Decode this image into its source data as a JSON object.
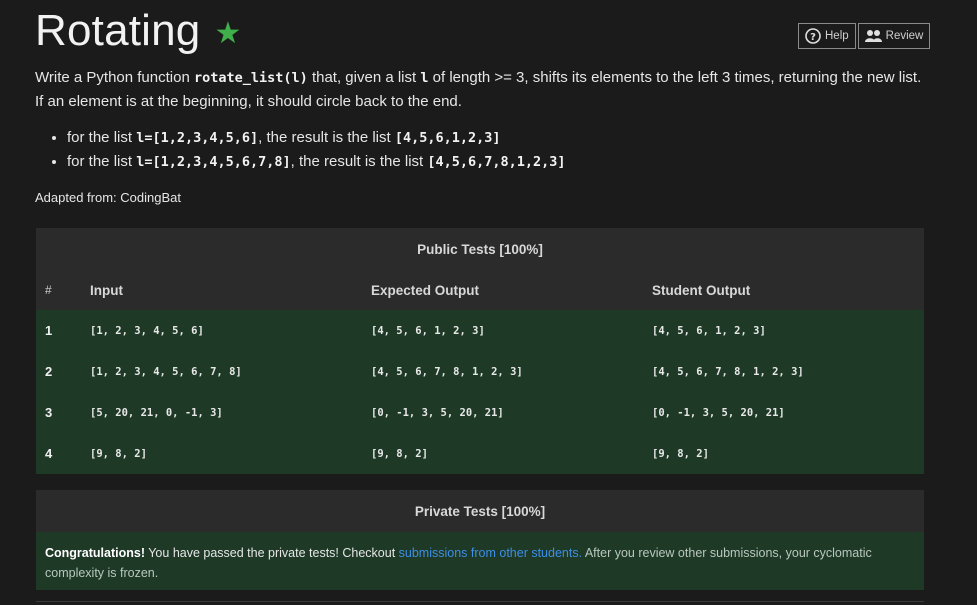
{
  "title": "Rotating",
  "header_buttons": {
    "help": "Help",
    "review": "Review"
  },
  "description": {
    "p1": "Write a Python function ",
    "func": "rotate_list(l)",
    "p2": " that, given a list ",
    "var": "l",
    "p3": " of length >= 3, shifts its elements to the left 3 times, returning the new list. If an element is at the beginning, it should circle back to the end."
  },
  "examples": [
    {
      "pre": "for the list ",
      "input": "l=[1,2,3,4,5,6]",
      "mid": ", the result is the list ",
      "output": "[4,5,6,1,2,3]"
    },
    {
      "pre": "for the list ",
      "input": "l=[1,2,3,4,5,6,7,8]",
      "mid": ", the result is the list ",
      "output": "[4,5,6,7,8,1,2,3]"
    }
  ],
  "adapted": "Adapted from: CodingBat",
  "public_tests": {
    "title": "Public Tests [100%]",
    "columns": [
      "#",
      "Input",
      "Expected Output",
      "Student Output"
    ],
    "rows": [
      [
        "1",
        "[1, 2, 3, 4, 5, 6]",
        "[4, 5, 6, 1, 2, 3]",
        "[4, 5, 6, 1, 2, 3]"
      ],
      [
        "2",
        "[1, 2, 3, 4, 5, 6, 7, 8]",
        "[4, 5, 6, 7, 8, 1, 2, 3]",
        "[4, 5, 6, 7, 8, 1, 2, 3]"
      ],
      [
        "3",
        "[5, 20, 21, 0, -1, 3]",
        "[0, -1, 3, 5, 20, 21]",
        "[0, -1, 3, 5, 20, 21]"
      ],
      [
        "4",
        "[9, 8, 2]",
        "[9, 8, 2]",
        "[9, 8, 2]"
      ]
    ]
  },
  "private_tests": {
    "title": "Private Tests [100%]",
    "congrats": "Congratulations!",
    "msg": " You have passed the private tests! Checkout ",
    "link": "submissions from other students.",
    "rest": " After you review other submissions, your cyclomatic complexity is frozen."
  },
  "colors": {
    "star": "#3fb04a",
    "pass_row": "#1e3a27",
    "link": "#3d8ee6"
  }
}
